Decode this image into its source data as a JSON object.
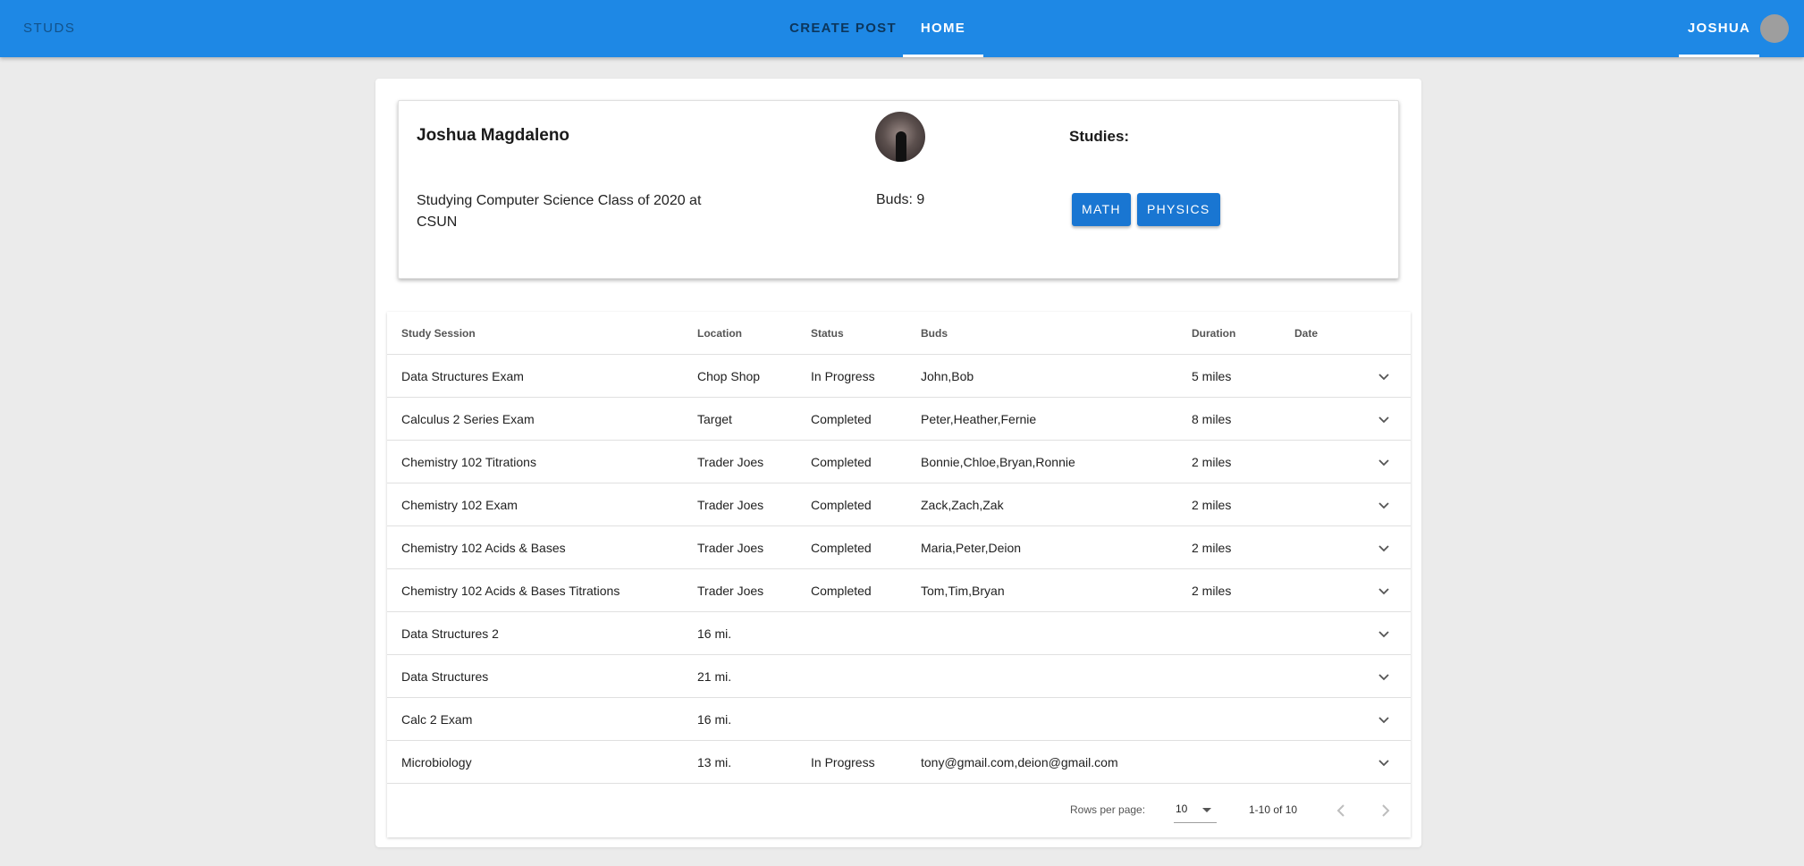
{
  "header": {
    "brand": "STUDS",
    "tabs": [
      {
        "label": "CREATE POST"
      },
      {
        "label": "HOME"
      }
    ],
    "user": "JOSHUA"
  },
  "profile": {
    "name": "Joshua Magdaleno",
    "bio": "Studying Computer Science Class of 2020 at CSUN",
    "buds": "Buds: 9",
    "studies_label": "Studies:",
    "studies": [
      "MATH",
      "PHYSICS"
    ]
  },
  "table": {
    "columns": [
      "Study Session",
      "Location",
      "Status",
      "Buds",
      "Duration",
      "Date"
    ],
    "rows": [
      {
        "session": "Data Structures Exam",
        "location": "Chop Shop",
        "status": "In Progress",
        "buds": "John,Bob",
        "duration": "5 miles",
        "date": ""
      },
      {
        "session": "Calculus 2 Series Exam",
        "location": "Target",
        "status": "Completed",
        "buds": "Peter,Heather,Fernie",
        "duration": "8 miles",
        "date": ""
      },
      {
        "session": "Chemistry 102 Titrations",
        "location": "Trader Joes",
        "status": "Completed",
        "buds": "Bonnie,Chloe,Bryan,Ronnie",
        "duration": "2 miles",
        "date": ""
      },
      {
        "session": "Chemistry 102 Exam",
        "location": "Trader Joes",
        "status": "Completed",
        "buds": "Zack,Zach,Zak",
        "duration": "2 miles",
        "date": ""
      },
      {
        "session": "Chemistry 102 Acids & Bases",
        "location": "Trader Joes",
        "status": "Completed",
        "buds": "Maria,Peter,Deion",
        "duration": "2 miles",
        "date": ""
      },
      {
        "session": "Chemistry 102 Acids & Bases Titrations",
        "location": "Trader Joes",
        "status": "Completed",
        "buds": "Tom,Tim,Bryan",
        "duration": "2 miles",
        "date": ""
      },
      {
        "session": "Data Structures 2",
        "location": "16 mi.",
        "status": "",
        "buds": "",
        "duration": "",
        "date": ""
      },
      {
        "session": "Data Structures",
        "location": "21 mi.",
        "status": "",
        "buds": "",
        "duration": "",
        "date": ""
      },
      {
        "session": "Calc 2 Exam",
        "location": "16 mi.",
        "status": "",
        "buds": "",
        "duration": "",
        "date": ""
      },
      {
        "session": "Microbiology",
        "location": "13 mi.",
        "status": "In Progress",
        "buds": "tony@gmail.com,deion@gmail.com",
        "duration": "",
        "date": ""
      }
    ],
    "footer": {
      "rows_per_page_label": "Rows per page:",
      "rows_per_page": "10",
      "range": "1-10 of 10"
    }
  },
  "icons": {
    "row_expand": "chevron-down-icon",
    "prev": "chevron-left-icon",
    "next": "chevron-right-icon"
  },
  "colors": {
    "appbar": "#1e88e5",
    "chip": "#1976d2",
    "background": "#ebebeb"
  }
}
